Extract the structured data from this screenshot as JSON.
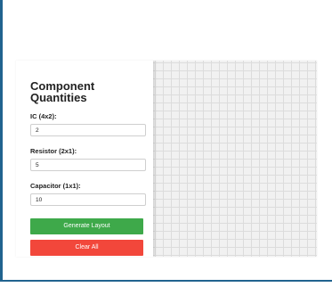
{
  "sidebar": {
    "title": "Component Quantities",
    "fields": [
      {
        "label": "IC (4x2):",
        "value": "2"
      },
      {
        "label": "Resistor (2x1):",
        "value": "5"
      },
      {
        "label": "Capacitor (1x1):",
        "value": "10"
      }
    ],
    "generate_label": "Generate Layout",
    "clear_label": "Clear All"
  },
  "colors": {
    "generate_button": "#3ea94a",
    "clear_button": "#f2473b",
    "window_edge": "#21638f",
    "grid_line": "#dcdcdc"
  }
}
